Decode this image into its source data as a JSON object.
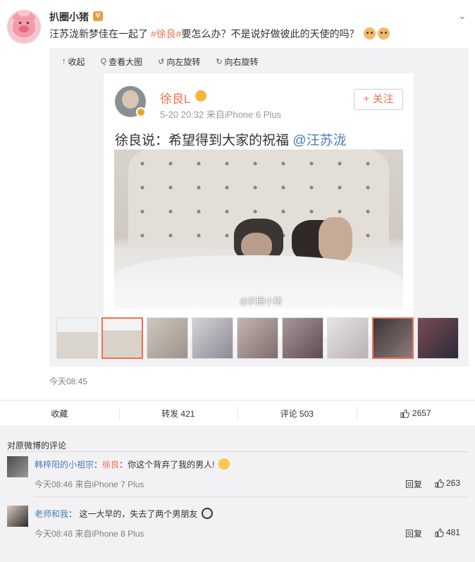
{
  "post": {
    "username": "扒圈小猪",
    "text_prefix": "汪苏泷新梦佳在一起了",
    "tag": "#徐良#",
    "text_suffix": "要怎么办？不是说好做彼此的天使的吗？",
    "time": "今天08:45"
  },
  "media": {
    "toolbar": [
      {
        "icon": "collapse-icon",
        "glyph": "↑",
        "label": "收起"
      },
      {
        "icon": "zoom-icon",
        "glyph": "Q",
        "label": "查看大图"
      },
      {
        "icon": "rotate-left-icon",
        "glyph": "↺",
        "label": "向左旋转"
      },
      {
        "icon": "rotate-right-icon",
        "glyph": "↻",
        "label": "向右旋转"
      }
    ],
    "embedded_post": {
      "name": "徐良L",
      "meta": "5-20 20:32  来自iPhone 6 Plus",
      "follow_label": "+ 关注",
      "text": "徐良说：希望得到大家的祝福 ",
      "mention": "@汪苏泷"
    },
    "watermark": "@扒圈小猪",
    "thumbnail_count": 9,
    "selected_thumbnail_index": 1
  },
  "actions": {
    "favorite": "收藏",
    "repost": "转发 421",
    "comment": "评论 503",
    "like": "2657"
  },
  "comments_section": {
    "title": "对原微博的评论",
    "comments": [
      {
        "user": "韩梓阳的小祖宗",
        "mention": "徐良",
        "text": "你这个背弃了我的男人!",
        "meta": "今天08:46 来自iPhone 7 Plus",
        "reply_label": "回复",
        "likes": "263"
      },
      {
        "user": "老师和我",
        "mention": "",
        "text": "这一大早的，失去了两个男朋友",
        "meta": "今天08:48 来自iPhone 8 Plus",
        "reply_label": "回复",
        "likes": "481"
      }
    ]
  },
  "colors": {
    "accent": "#eb7350",
    "link": "#4a7db5",
    "muted": "#808080",
    "panel": "#f2f2f5"
  }
}
